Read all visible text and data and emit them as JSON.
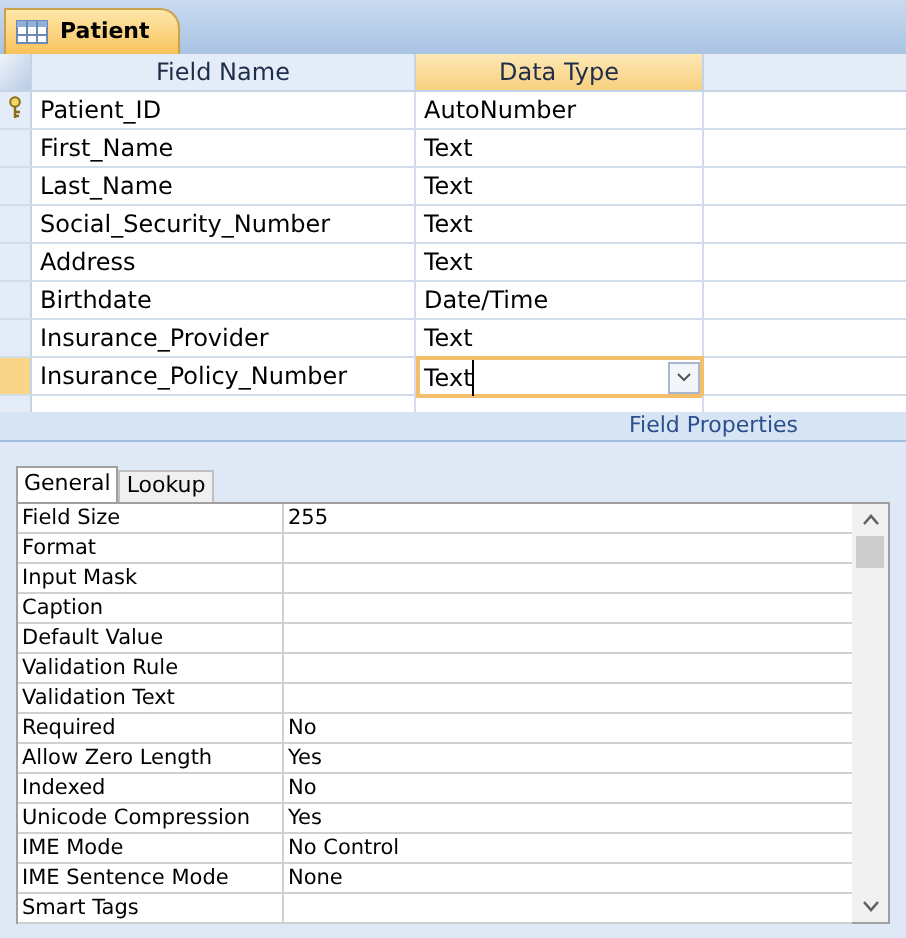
{
  "document_tab": {
    "title": "Patient",
    "selected": true
  },
  "columns": [
    "Field Name",
    "Data Type"
  ],
  "fields": [
    {
      "name": "Patient_ID",
      "type": "AutoNumber",
      "primary_key": true,
      "selected": false
    },
    {
      "name": "First_Name",
      "type": "Text",
      "primary_key": false,
      "selected": false
    },
    {
      "name": "Last_Name",
      "type": "Text",
      "primary_key": false,
      "selected": false
    },
    {
      "name": "Social_Security_Number",
      "type": "Text",
      "primary_key": false,
      "selected": false
    },
    {
      "name": "Address",
      "type": "Text",
      "primary_key": false,
      "selected": false
    },
    {
      "name": "Birthdate",
      "type": "Date/Time",
      "primary_key": false,
      "selected": false
    },
    {
      "name": "Insurance_Provider",
      "type": "Text",
      "primary_key": false,
      "selected": false
    },
    {
      "name": "Insurance_Policy_Number",
      "type": "Text",
      "primary_key": false,
      "selected": true
    }
  ],
  "field_properties": {
    "title": "Field Properties",
    "tabs": [
      {
        "label": "General",
        "selected": true
      },
      {
        "label": "Lookup",
        "selected": false
      }
    ],
    "properties": [
      {
        "label": "Field Size",
        "value": "255"
      },
      {
        "label": "Format"
      },
      {
        "label": "Input Mask"
      },
      {
        "label": "Caption"
      },
      {
        "label": "Default Value"
      },
      {
        "label": "Validation Rule"
      },
      {
        "label": "Validation Text"
      },
      {
        "label": "Required",
        "value": "No"
      },
      {
        "label": "Allow Zero Length",
        "value": "Yes"
      },
      {
        "label": "Indexed",
        "value": "No"
      },
      {
        "label": "Unicode Compression",
        "value": "Yes"
      },
      {
        "label": "IME Mode",
        "value": "No Control"
      },
      {
        "label": "IME Sentence Mode",
        "value": "None"
      },
      {
        "label": "Smart Tags"
      }
    ]
  }
}
